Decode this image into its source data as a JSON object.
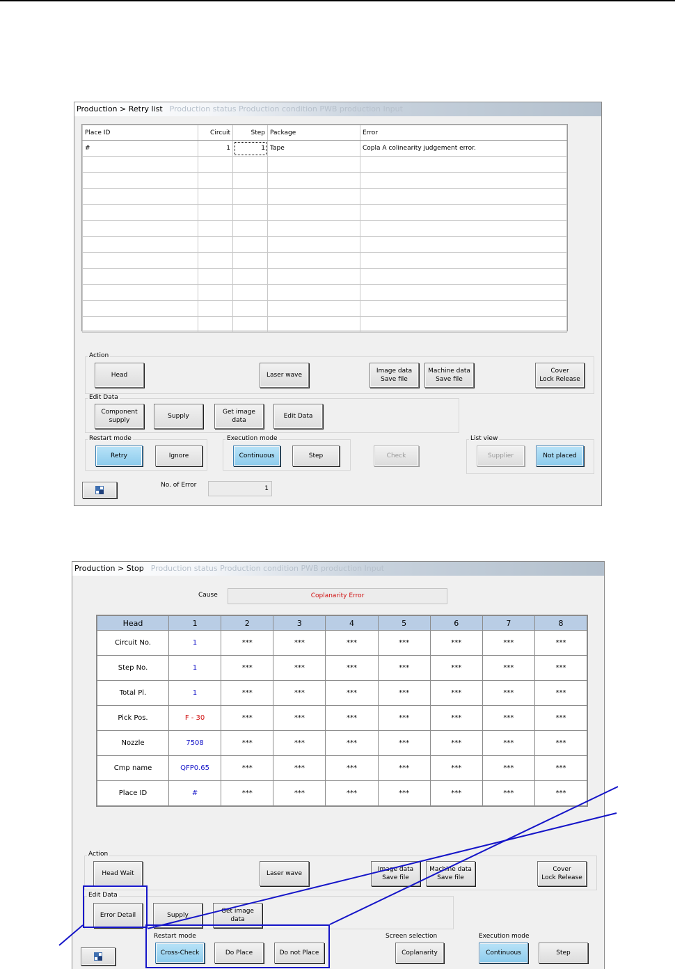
{
  "retry_window": {
    "title": "Production > Retry list",
    "title_faint": "Production status Production condition   PWB production   Input",
    "columns": [
      "Place ID",
      "Circuit",
      "Step",
      "Package",
      "Error"
    ],
    "rows": [
      [
        "#",
        "1",
        "1",
        "Tape",
        "Copla  A colinearity judgement error."
      ],
      [
        "",
        "",
        "",
        "",
        ""
      ],
      [
        "",
        "",
        "",
        "",
        ""
      ],
      [
        "",
        "",
        "",
        "",
        ""
      ],
      [
        "",
        "",
        "",
        "",
        ""
      ],
      [
        "",
        "",
        "",
        "",
        ""
      ],
      [
        "",
        "",
        "",
        "",
        ""
      ],
      [
        "",
        "",
        "",
        "",
        ""
      ],
      [
        "",
        "",
        "",
        "",
        ""
      ],
      [
        "",
        "",
        "",
        "",
        ""
      ],
      [
        "",
        "",
        "",
        "",
        ""
      ],
      [
        "",
        "",
        "",
        "",
        ""
      ]
    ],
    "action": {
      "label": "Action",
      "head": "Head",
      "laser_wave": "Laser wave",
      "image_save": "Image data\nSave file",
      "machine_save": "Machine data\nSave file",
      "cover_release": "Cover\nLock Release"
    },
    "edit_data": {
      "label": "Edit Data",
      "component_supply": "Component\nsupply",
      "supply": "Supply",
      "get_image": "Get image data",
      "edit_data": "Edit Data"
    },
    "restart_mode": {
      "label": "Restart mode",
      "retry": "Retry",
      "ignore": "Ignore"
    },
    "execution_mode": {
      "label": "Execution mode",
      "continuous": "Continuous",
      "step": "Step"
    },
    "check": "Check",
    "list_view": {
      "label": "List view",
      "supplier": "Supplier",
      "not_placed": "Not placed"
    },
    "error_count_label": "No. of Error",
    "error_count": "1"
  },
  "stop_window": {
    "title": "Production > Stop",
    "title_faint": "Production status Production condition   PWB production   Input",
    "cause_label": "Cause",
    "cause_value": "Coplanarity Error",
    "head_table": {
      "columns": [
        "Head",
        "1",
        "2",
        "3",
        "4",
        "5",
        "6",
        "7",
        "8"
      ],
      "rows": [
        {
          "label": "Circuit No.",
          "v1": "1",
          "c1": "blue",
          "rest": "***"
        },
        {
          "label": "Step No.",
          "v1": "1",
          "c1": "blue",
          "rest": "***"
        },
        {
          "label": "Total Pl.",
          "v1": "1",
          "c1": "blue",
          "rest": "***"
        },
        {
          "label": "Pick Pos.",
          "v1": "F - 30",
          "c1": "red",
          "rest": "***"
        },
        {
          "label": "Nozzle",
          "v1": "7508",
          "c1": "blue",
          "rest": "***"
        },
        {
          "label": "Cmp name",
          "v1": "QFP0.65",
          "c1": "blue",
          "rest": "***"
        },
        {
          "label": "Place ID",
          "v1": "#",
          "c1": "blue",
          "rest": "***"
        }
      ]
    },
    "action": {
      "label": "Action",
      "head_wait": "Head Wait",
      "laser_wave": "Laser wave",
      "image_save": "Image data\nSave file",
      "machine_save": "Machine data\nSave file",
      "cover_release": "Cover\nLock Release"
    },
    "edit_data": {
      "label": "Edit Data",
      "error_detail": "Error Detail",
      "supply": "Supply",
      "get_image": "Get image data"
    },
    "restart_mode": {
      "label": "Restart mode",
      "cross_check": "Cross-Check",
      "do_place": "Do Place",
      "do_not_place": "Do not Place"
    },
    "screen_selection": {
      "label": "Screen selection",
      "coplanarity": "Coplanarity"
    },
    "execution_mode": {
      "label": "Execution mode",
      "continuous": "Continuous",
      "step": "Step"
    }
  },
  "colors": {
    "highlight": "#1515c8",
    "active_button": "#8ccbec",
    "table_header": "#b9cde5",
    "value_blue": "#1414c8",
    "value_red": "#d01010"
  }
}
